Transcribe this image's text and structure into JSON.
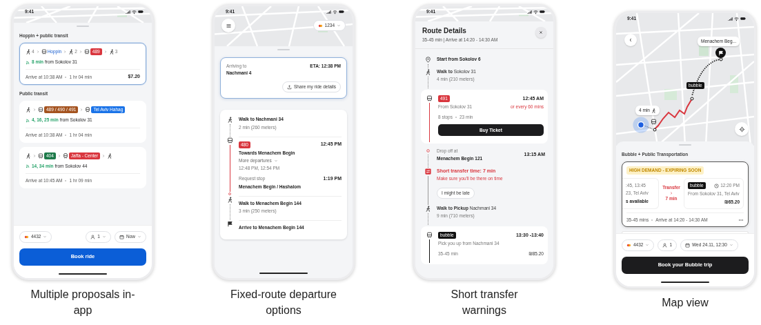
{
  "phones": [
    {
      "kind": "proposals",
      "caption": "Multiple proposals in-app",
      "time": "9:41",
      "sections": [
        {
          "title": "Hoppin + public transit",
          "options": [
            {
              "selected": true,
              "legs": [
                {
                  "kind": "walk",
                  "count": "4"
                },
                {
                  "kind": "hoppin",
                  "label": "Hoppin"
                },
                {
                  "kind": "walk",
                  "count": "2"
                },
                {
                  "kind": "bus",
                  "badge": "489",
                  "color": "#d9363e"
                },
                {
                  "kind": "walk",
                  "count": "3"
                }
              ],
              "eta": "8 min",
              "from": "from Sokolov 31",
              "arrive": "Arrive at 10:38 AM",
              "duration": "1 hr 04 min",
              "price": "$7.20"
            }
          ]
        },
        {
          "title": "Public transit",
          "options": [
            {
              "selected": false,
              "legs": [
                {
                  "kind": "walk"
                },
                {
                  "kind": "bus",
                  "badge": "489 / 490 / 491",
                  "color": "#a4531f"
                },
                {
                  "kind": "train",
                  "badge": "Tel Aviv Hahag",
                  "color": "#1a73e8"
                }
              ],
              "eta": "4, 16, 25 min",
              "from": "from Sokolov 31",
              "arrive": "Arrive at 10:38 AM",
              "duration": "1 hr 04 min"
            },
            {
              "selected": false,
              "legs": [
                {
                  "kind": "walk"
                },
                {
                  "kind": "bus",
                  "badge": "404",
                  "color": "#1e7a4a"
                },
                {
                  "kind": "train",
                  "badge": "Jaffa - Center",
                  "color": "#d9363e"
                },
                {
                  "kind": "walk"
                }
              ],
              "eta": "14, 34 min",
              "from": "from Sokolov 44",
              "arrive": "Arrive at 10:45 AM",
              "duration": "1 hr 09 min"
            }
          ]
        }
      ],
      "payment": "4432",
      "passengers": "1",
      "when": "Now",
      "book": "Book ride"
    },
    {
      "kind": "departures",
      "caption": "Fixed-route departure options",
      "time": "9:41",
      "payment": "1234",
      "arrival": {
        "label": "Arriving to",
        "place": "Nachmani 4",
        "eta": "ETA: 12:38 PM",
        "share": "Share my ride details"
      },
      "steps": [
        {
          "kind": "walk",
          "title": "Walk to Nachmani 34",
          "detail": "2 min (260 meters)"
        },
        {
          "kind": "bus",
          "badge": "480",
          "time": "12:45 PM",
          "title": "Towards Menachem Begin",
          "more": "More departures",
          "more_times": "12:48 PM, 12:54 PM",
          "stop_label": "Request stop",
          "stop_time": "1:19 PM",
          "stop": "Menachem Begin / Hashalom"
        },
        {
          "kind": "walk",
          "title": "Walk to Menachem Begin 144",
          "detail": "3 min (250 meters)"
        },
        {
          "kind": "arrive",
          "title": "Arrive to Menachem Begin 144"
        }
      ]
    },
    {
      "kind": "transfer",
      "caption": "Short transfer warnings",
      "time": "9:41",
      "title": "Route Details",
      "summary": "35-45 min | Arrive at 14:20 - 14:30 AM",
      "steps": [
        {
          "kind": "start",
          "title": "Start from Sokolov 6"
        },
        {
          "kind": "walk",
          "title": "**Walk to** Sokolov 31",
          "detail": "4 min (210 meters)"
        },
        {
          "kind": "bus",
          "badge": "491",
          "time": "12:45 AM",
          "frequency": "or every 60 mins",
          "from": "From Sokolov 31",
          "stops": "8 stops",
          "duration": "23 min",
          "action": "Buy Ticket"
        },
        {
          "kind": "dropoff",
          "label": "Drop off at",
          "title": "Menachem Begin 121",
          "time": "13:15 AM"
        },
        {
          "kind": "warning",
          "title": "Short transfer time: 7 min",
          "detail": "Make sure you'll be there on time",
          "action": "I might be late"
        },
        {
          "kind": "walk",
          "title": "**Walk to Pickup** Nachmani 34",
          "detail": "9 min (710 meters)"
        },
        {
          "kind": "shuttle",
          "badge": "bubble",
          "time": "13:30 -13:40",
          "from": "Pick you up from Nachmani 34",
          "duration": "35-45 min",
          "price": "₪85.20"
        }
      ]
    },
    {
      "kind": "map",
      "caption": "Map view",
      "time": "9:41",
      "destination": "Menachem Beg...",
      "shuttle_badge": "bubble",
      "walk_time": "4 min",
      "section": "Bubble + Public Transportation",
      "offer": {
        "tag": "HIGH DEMAND - EXPIRING SOON",
        "left": [
          ":45, 13:45",
          "23, Tel Aviv",
          "s available"
        ],
        "transfer": "Transfer",
        "transfer_time": "7 min",
        "badge": "bubble",
        "pickup_time": "12:20 PM",
        "from": "From Sokolov 31, Tel Aviv",
        "price": "₪65.20",
        "duration": "35-45 mins",
        "arrive": "Arrive at 14:20 - 14:30 AM"
      },
      "payment": "4432",
      "passengers": "1",
      "when": "Wed 24.11, 12:30",
      "book": "Book your Bubble trip"
    }
  ]
}
